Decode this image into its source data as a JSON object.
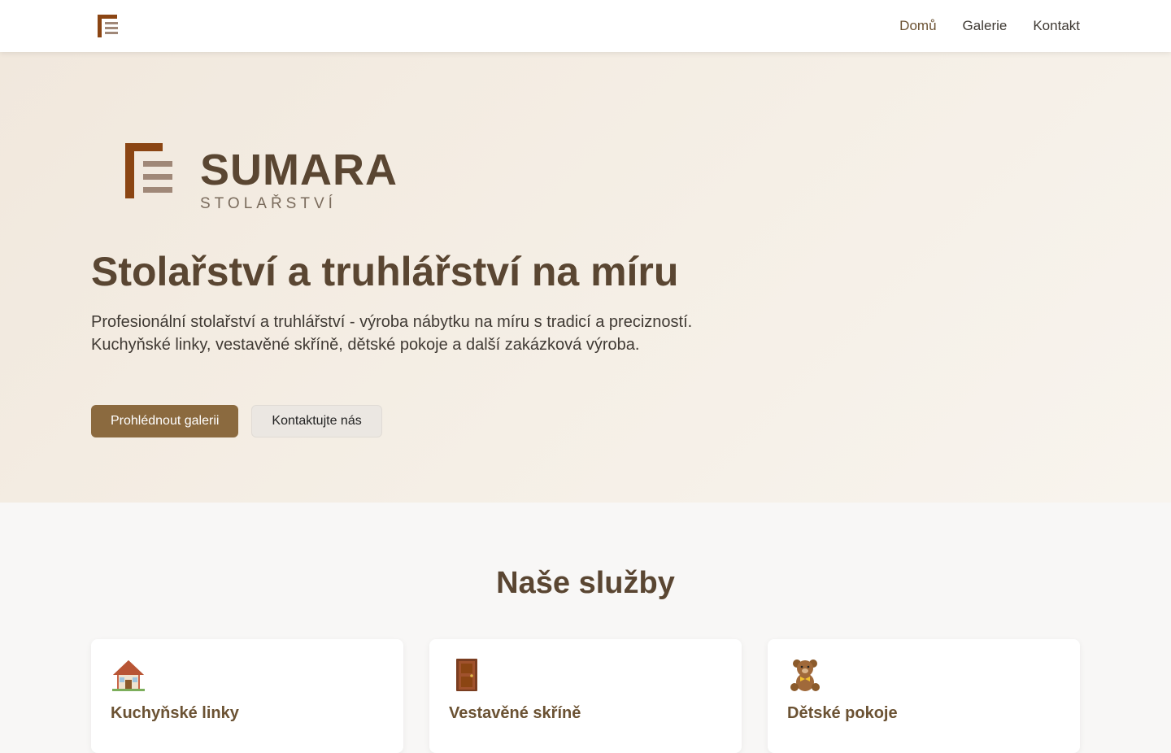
{
  "nav": {
    "logo_icon": "sumara-logo-icon",
    "links": [
      {
        "label": "Domů",
        "active": true
      },
      {
        "label": "Galerie",
        "active": false
      },
      {
        "label": "Kontakt",
        "active": false
      }
    ]
  },
  "hero": {
    "brand_name": "SUMARA",
    "brand_sub": "STOLAŘSTVÍ",
    "title": "Stolařství a truhlářství na míru",
    "description": "Profesionální stolařství a truhlářství - výroba nábytku na míru s tradicí a precizností. Kuchyňské linky, vestavěné skříně, dětské pokoje a další zakázková výroba.",
    "primary_button": "Prohlédnout galerii",
    "secondary_button": "Kontaktujte nás"
  },
  "services": {
    "title": "Naše služby",
    "items": [
      {
        "icon": "house-icon",
        "title": "Kuchyňské linky"
      },
      {
        "icon": "door-icon",
        "title": "Vestavěné skříně"
      },
      {
        "icon": "teddy-bear-icon",
        "title": "Dětské pokoje"
      }
    ]
  },
  "colors": {
    "brand_dark": "#5a4632",
    "accent": "#8b6a3f",
    "logo_bar": "#8b4513",
    "logo_lines": "#a08878"
  }
}
